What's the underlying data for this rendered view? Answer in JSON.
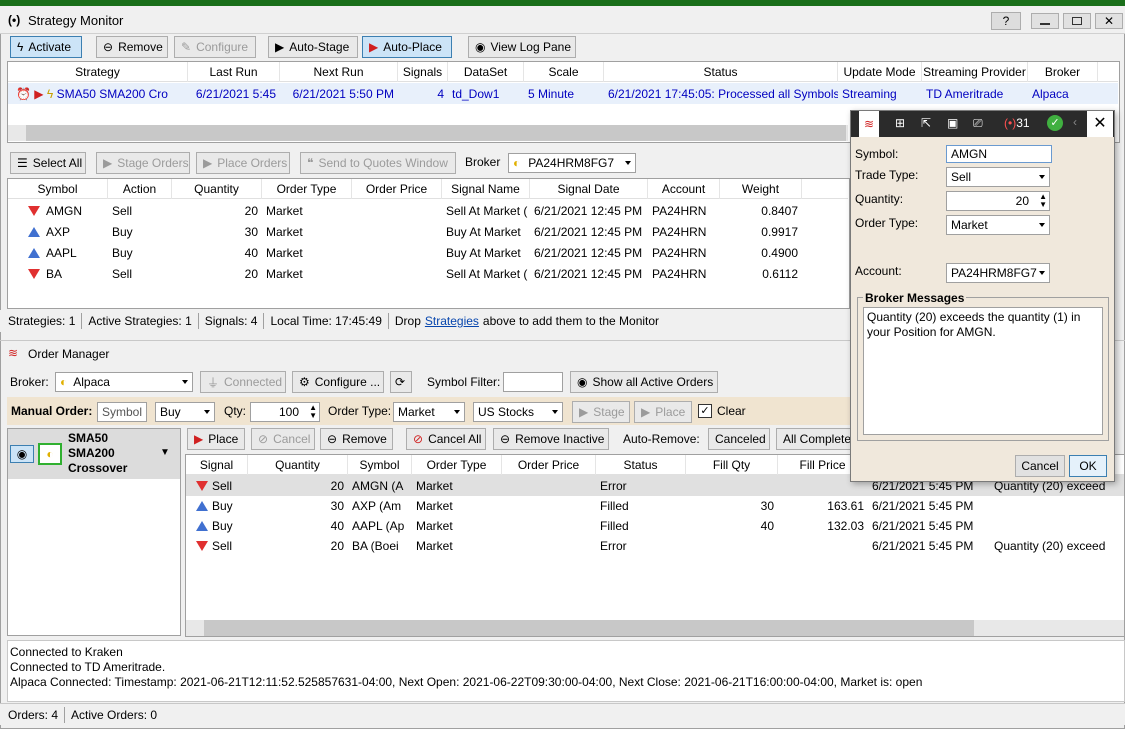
{
  "window": {
    "title": "Strategy Monitor",
    "help": "?"
  },
  "toolbar": {
    "activate": "Activate",
    "remove": "Remove",
    "configure": "Configure",
    "auto_stage": "Auto-Stage",
    "auto_place": "Auto-Place",
    "view_log": "View Log Pane"
  },
  "strategy_grid": {
    "headers": [
      "Strategy",
      "Last Run",
      "Next Run",
      "Signals",
      "DataSet",
      "Scale",
      "Status",
      "Update Mode",
      "Streaming Provider",
      "Broker"
    ],
    "row": {
      "strategy": "SMA50 SMA200 Cro",
      "last_run": "6/21/2021 5:45",
      "next_run": "6/21/2021 5:50 PM",
      "signals": "4",
      "dataset": "td_Dow1",
      "scale": "5 Minute",
      "status": "6/21/2021 17:45:05: Processed all Symbols",
      "update_mode": "Streaming",
      "provider": "TD Ameritrade",
      "broker": "Alpaca"
    }
  },
  "signals_toolbar": {
    "select_all": "Select All",
    "stage_orders": "Stage Orders",
    "place_orders": "Place Orders",
    "send_quotes": "Send to Quotes Window",
    "broker_label": "Broker",
    "broker_value": "PA24HRM8FG7"
  },
  "signals_grid": {
    "headers": [
      "Symbol",
      "Action",
      "Quantity",
      "Order Type",
      "Order Price",
      "Signal Name",
      "Signal Date",
      "Account",
      "Weight"
    ],
    "rows": [
      {
        "symbol": "AMGN",
        "action": "Sell",
        "qty": "20",
        "type": "Market",
        "price": "",
        "name": "Sell At Market (",
        "date": "6/21/2021 12:45 PM",
        "account": "PA24HRN",
        "weight": "0.8407",
        "dir": "down"
      },
      {
        "symbol": "AXP",
        "action": "Buy",
        "qty": "30",
        "type": "Market",
        "price": "",
        "name": "Buy At Market",
        "date": "6/21/2021 12:45 PM",
        "account": "PA24HRN",
        "weight": "0.9917",
        "dir": "up"
      },
      {
        "symbol": "AAPL",
        "action": "Buy",
        "qty": "40",
        "type": "Market",
        "price": "",
        "name": "Buy At Market",
        "date": "6/21/2021 12:45 PM",
        "account": "PA24HRN",
        "weight": "0.4900",
        "dir": "up"
      },
      {
        "symbol": "BA",
        "action": "Sell",
        "qty": "20",
        "type": "Market",
        "price": "",
        "name": "Sell At Market (",
        "date": "6/21/2021 12:45 PM",
        "account": "PA24HRN",
        "weight": "0.6112",
        "dir": "down"
      }
    ]
  },
  "status1": {
    "strategies": "Strategies: 1",
    "active": "Active Strategies: 1",
    "signals": "Signals: 4",
    "time": "Local Time: 17:45:49",
    "drop_pre": "Drop",
    "drop_link": "Strategies",
    "drop_post": "above to add them to the Monitor"
  },
  "order_manager": {
    "title": "Order Manager",
    "broker_label": "Broker:",
    "broker_value": "Alpaca",
    "connected": "Connected",
    "configure": "Configure ...",
    "symbol_filter": "Symbol Filter:",
    "show_all": "Show all Active Orders",
    "manual_label": "Manual Order:",
    "symbol_ph": "Symbol",
    "side": "Buy",
    "qty_label": "Qty:",
    "qty": "100",
    "type_label": "Order Type:",
    "type": "Market",
    "market": "US Stocks",
    "stage": "Stage",
    "place": "Place",
    "clear": "Clear"
  },
  "strategy_card": {
    "line1": "SMA50",
    "line2": "SMA200",
    "line3": "Crossover"
  },
  "orders_toolbar": {
    "place": "Place",
    "cancel": "Cancel",
    "remove": "Remove",
    "cancel_all": "Cancel All",
    "remove_inactive": "Remove Inactive",
    "auto_remove": "Auto-Remove:",
    "canceled": "Canceled",
    "all_complete": "All Complete"
  },
  "orders_grid": {
    "headers": [
      "Signal",
      "Quantity",
      "Symbol",
      "Order Type",
      "Order Price",
      "Status",
      "Fill Qty",
      "Fill Price"
    ],
    "rows": [
      {
        "signal": "Sell",
        "qty": "20",
        "symbol": "AMGN (A",
        "type": "Market",
        "price": "",
        "status": "Error",
        "fillqty": "",
        "fillprice": "",
        "date": "6/21/2021 5:45 PM",
        "msg": "Quantity (20) exceed",
        "dir": "down"
      },
      {
        "signal": "Buy",
        "qty": "30",
        "symbol": "AXP (Am",
        "type": "Market",
        "price": "",
        "status": "Filled",
        "fillqty": "30",
        "fillprice": "163.61",
        "date": "6/21/2021 5:45 PM",
        "msg": "",
        "dir": "up"
      },
      {
        "signal": "Buy",
        "qty": "40",
        "symbol": "AAPL (Ap",
        "type": "Market",
        "price": "",
        "status": "Filled",
        "fillqty": "40",
        "fillprice": "132.03",
        "date": "6/21/2021 5:45 PM",
        "msg": "",
        "dir": "up"
      },
      {
        "signal": "Sell",
        "qty": "20",
        "symbol": "BA (Boei",
        "type": "Market",
        "price": "",
        "status": "Error",
        "fillqty": "",
        "fillprice": "",
        "date": "6/21/2021 5:45 PM",
        "msg": "Quantity (20) exceed",
        "dir": "down"
      }
    ]
  },
  "log": [
    "Connected to Kraken",
    "Connected to TD Ameritrade.",
    "Alpaca Connected: Timestamp: 2021-06-21T12:11:52.525857631-04:00, Next Open: 2021-06-22T09:30:00-04:00, Next Close: 2021-06-21T16:00:00-04:00, Market is: open"
  ],
  "status2": {
    "orders": "Orders: 4",
    "active": "Active Orders: 0"
  },
  "dialog": {
    "badge_count": "31",
    "symbol_label": "Symbol:",
    "symbol": "AMGN",
    "trade_type_label": "Trade Type:",
    "trade_type": "Sell",
    "quantity_label": "Quantity:",
    "quantity": "20",
    "order_type_label": "Order Type:",
    "order_type": "Market",
    "account_label": "Account:",
    "account": "PA24HRM8FG7",
    "broker_msgs_label": "Broker Messages",
    "broker_msg": "Quantity (20) exceeds the quantity (1) in your Position for AMGN.",
    "cancel": "Cancel",
    "ok": "OK"
  }
}
